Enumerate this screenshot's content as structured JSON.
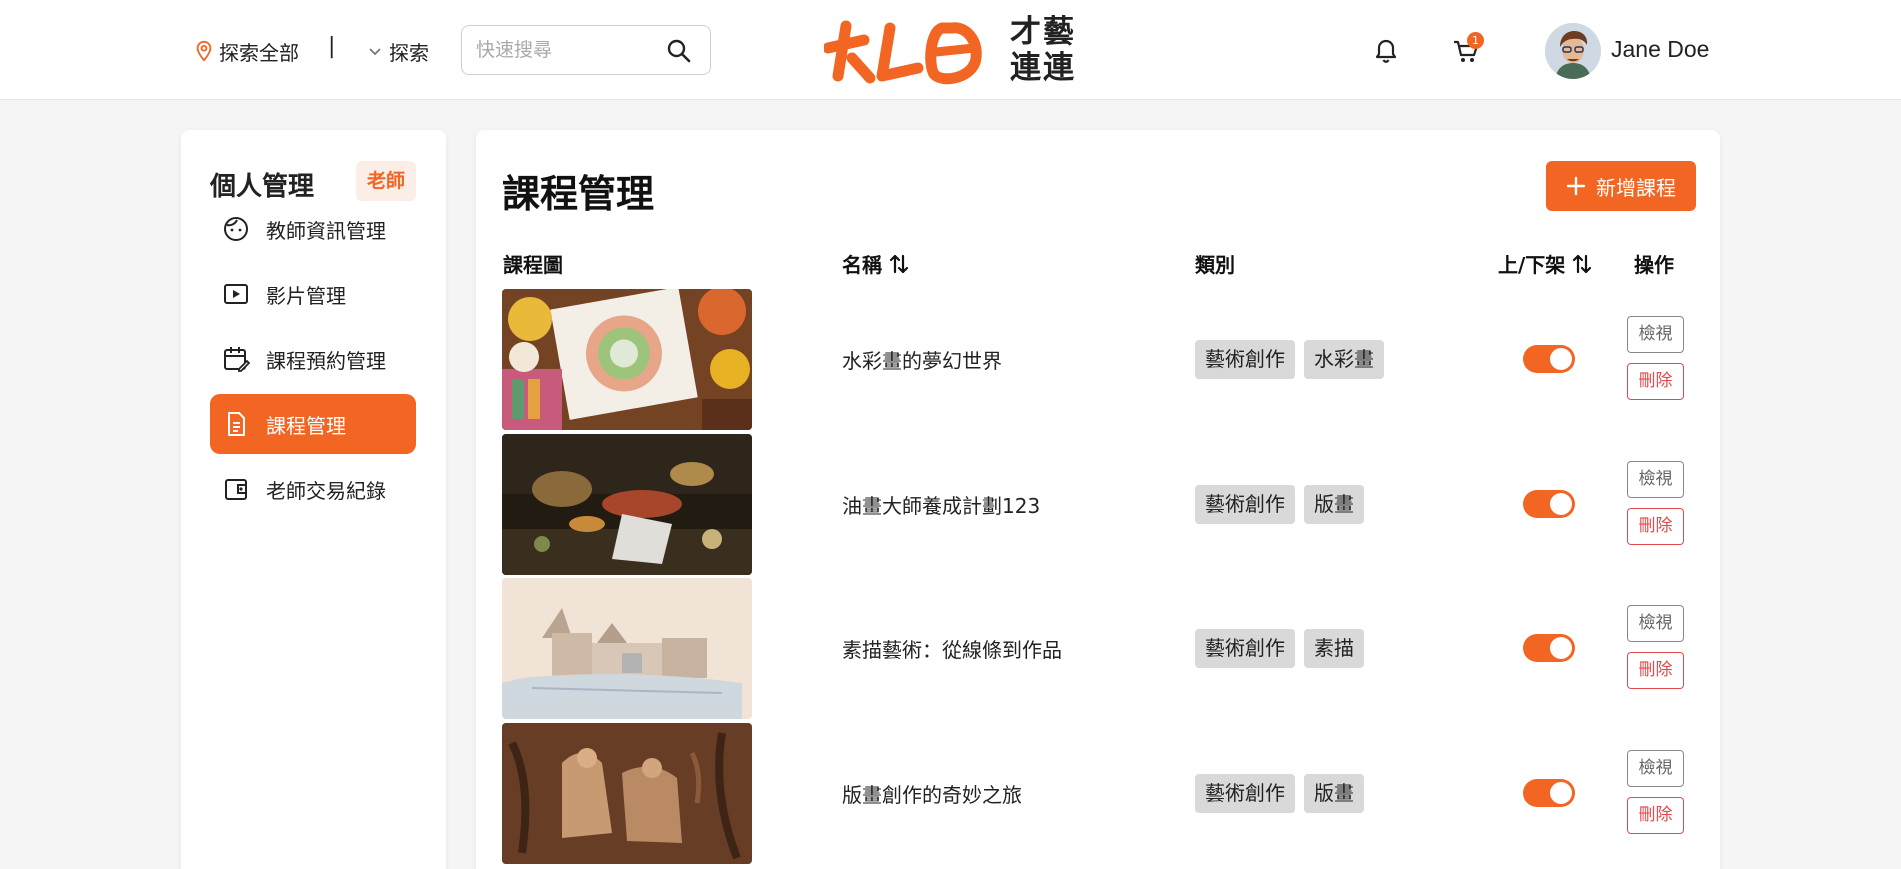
{
  "colors": {
    "accent": "#f26522",
    "tag_bg": "#d9d9d9",
    "danger": "#e24b4b"
  },
  "header": {
    "location_label": "探索全部",
    "separator": "|",
    "explore_label": "探索",
    "search_placeholder": "快速搜尋",
    "logo_text_line1": "才藝",
    "logo_text_line2": "連連",
    "cart_count": "1",
    "user_name": "Jane Doe"
  },
  "sidebar": {
    "title": "個人管理",
    "role_badge": "老師",
    "items": [
      {
        "label": "教師資訊管理",
        "icon": "face-icon",
        "active": false
      },
      {
        "label": "影片管理",
        "icon": "video-icon",
        "active": false
      },
      {
        "label": "課程預約管理",
        "icon": "calendar-edit-icon",
        "active": false
      },
      {
        "label": "課程管理",
        "icon": "document-icon",
        "active": true
      },
      {
        "label": "老師交易紀錄",
        "icon": "wallet-icon",
        "active": false
      }
    ]
  },
  "main": {
    "title": "課程管理",
    "add_button_label": "新增課程",
    "columns": {
      "image": "課程圖",
      "name": "名稱",
      "category": "類別",
      "status": "上/下架",
      "actions": "操作"
    },
    "view_label": "檢視",
    "delete_label": "刪除",
    "rows": [
      {
        "name": "水彩畫的夢幻世界",
        "tags": [
          "藝術創作",
          "水彩畫"
        ],
        "published": true,
        "image": "watercolor-painting"
      },
      {
        "name": "油畫大師養成計劃123",
        "tags": [
          "藝術創作",
          "版畫"
        ],
        "published": true,
        "image": "still-life-oil-painting"
      },
      {
        "name": "素描藝術：從線條到作品",
        "tags": [
          "藝術創作",
          "素描"
        ],
        "published": true,
        "image": "castle-sketch"
      },
      {
        "name": "版畫創作的奇妙之旅",
        "tags": [
          "藝術創作",
          "版畫"
        ],
        "published": true,
        "image": "wood-carving-relief"
      }
    ]
  }
}
